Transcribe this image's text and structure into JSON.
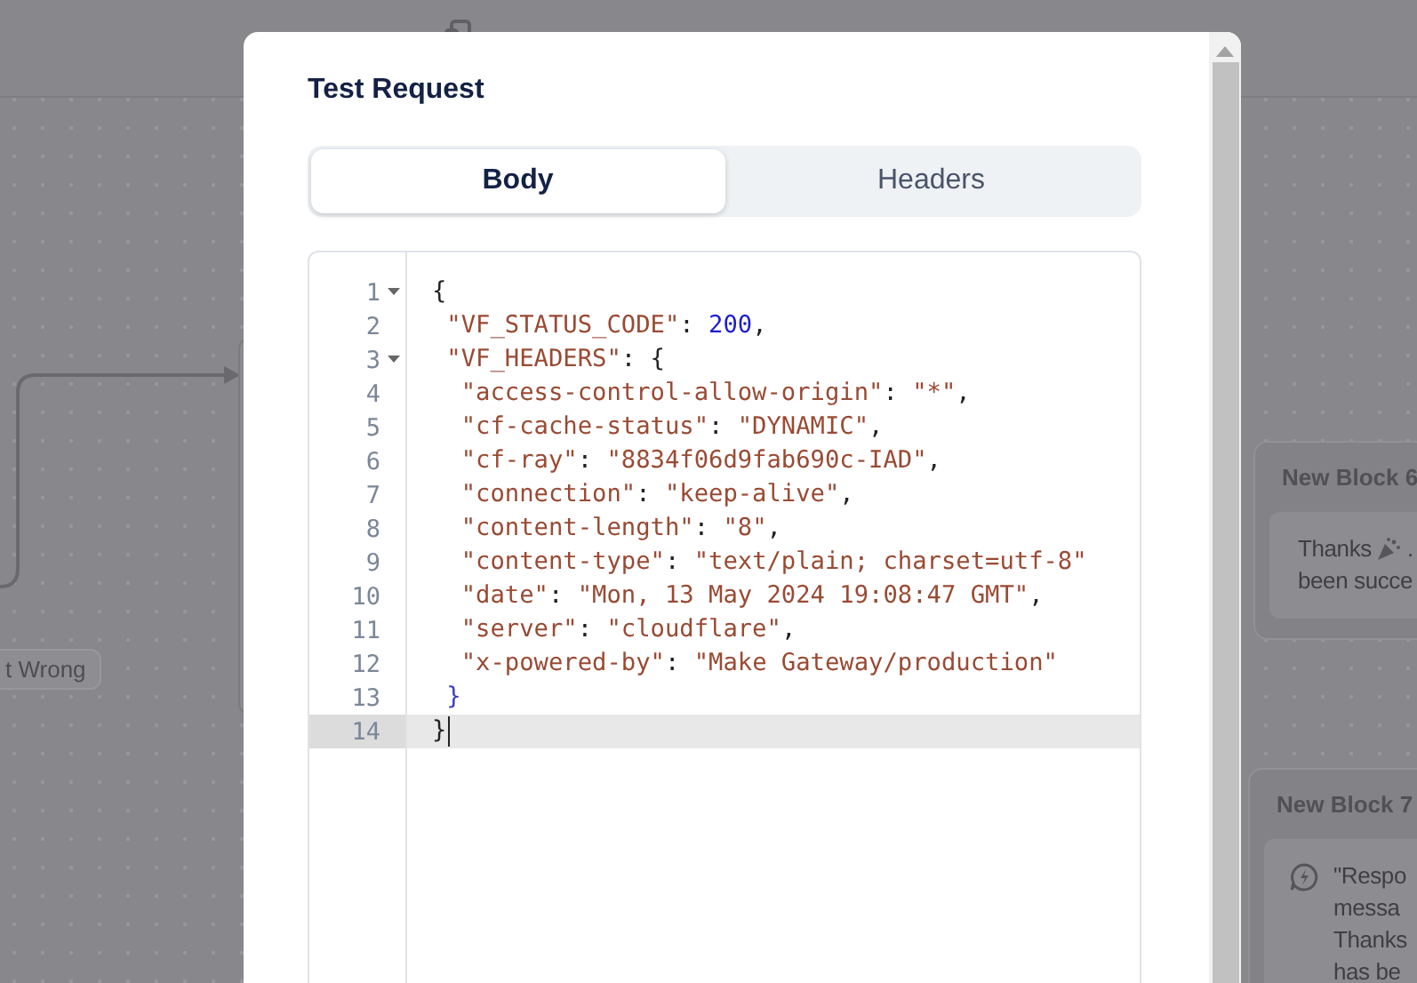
{
  "canvas": {
    "port_label": "t Wrong",
    "block_6": {
      "title": "New Block 6",
      "text_before_icon": "Thanks",
      "text_after_icon": ".",
      "second_line": "been succe"
    },
    "block_7": {
      "title": "New Block 7",
      "lines": [
        "\"Respo",
        "messa",
        "Thanks",
        "has be"
      ]
    }
  },
  "dialog": {
    "title": "Test Request",
    "tabs": [
      {
        "label": "Body",
        "selected": true
      },
      {
        "label": "Headers",
        "selected": false
      }
    ],
    "editor": {
      "lines": [
        {
          "number": "1",
          "fold": true,
          "active": false,
          "tokens": [
            {
              "kind": "punct",
              "text": "{"
            }
          ]
        },
        {
          "number": "2",
          "fold": false,
          "active": false,
          "tokens": [
            {
              "kind": "key",
              "text": " \"VF_STATUS_CODE\""
            },
            {
              "kind": "punct",
              "text": ": "
            },
            {
              "kind": "number",
              "text": "200"
            },
            {
              "kind": "punct",
              "text": ","
            }
          ]
        },
        {
          "number": "3",
          "fold": true,
          "active": false,
          "tokens": [
            {
              "kind": "key",
              "text": " \"VF_HEADERS\""
            },
            {
              "kind": "punct",
              "text": ": {"
            }
          ]
        },
        {
          "number": "4",
          "fold": false,
          "active": false,
          "tokens": [
            {
              "kind": "key",
              "text": "  \"access-control-allow-origin\""
            },
            {
              "kind": "punct",
              "text": ": "
            },
            {
              "kind": "string",
              "text": "\"*\""
            },
            {
              "kind": "punct",
              "text": ","
            }
          ]
        },
        {
          "number": "5",
          "fold": false,
          "active": false,
          "tokens": [
            {
              "kind": "key",
              "text": "  \"cf-cache-status\""
            },
            {
              "kind": "punct",
              "text": ": "
            },
            {
              "kind": "string",
              "text": "\"DYNAMIC\""
            },
            {
              "kind": "punct",
              "text": ","
            }
          ]
        },
        {
          "number": "6",
          "fold": false,
          "active": false,
          "tokens": [
            {
              "kind": "key",
              "text": "  \"cf-ray\""
            },
            {
              "kind": "punct",
              "text": ": "
            },
            {
              "kind": "string",
              "text": "\"8834f06d9fab690c-IAD\""
            },
            {
              "kind": "punct",
              "text": ","
            }
          ]
        },
        {
          "number": "7",
          "fold": false,
          "active": false,
          "tokens": [
            {
              "kind": "key",
              "text": "  \"connection\""
            },
            {
              "kind": "punct",
              "text": ": "
            },
            {
              "kind": "string",
              "text": "\"keep-alive\""
            },
            {
              "kind": "punct",
              "text": ","
            }
          ]
        },
        {
          "number": "8",
          "fold": false,
          "active": false,
          "tokens": [
            {
              "kind": "key",
              "text": "  \"content-length\""
            },
            {
              "kind": "punct",
              "text": ": "
            },
            {
              "kind": "string",
              "text": "\"8\""
            },
            {
              "kind": "punct",
              "text": ","
            }
          ]
        },
        {
          "number": "9",
          "fold": false,
          "active": false,
          "tokens": [
            {
              "kind": "key",
              "text": "  \"content-type\""
            },
            {
              "kind": "punct",
              "text": ": "
            },
            {
              "kind": "string",
              "text": "\"text/plain; charset=utf-8\""
            }
          ]
        },
        {
          "number": "10",
          "fold": false,
          "active": false,
          "tokens": [
            {
              "kind": "key",
              "text": "  \"date\""
            },
            {
              "kind": "punct",
              "text": ": "
            },
            {
              "kind": "string",
              "text": "\"Mon, 13 May 2024 19:08:47 GMT\""
            },
            {
              "kind": "punct",
              "text": ","
            }
          ]
        },
        {
          "number": "11",
          "fold": false,
          "active": false,
          "tokens": [
            {
              "kind": "key",
              "text": "  \"server\""
            },
            {
              "kind": "punct",
              "text": ": "
            },
            {
              "kind": "string",
              "text": "\"cloudflare\""
            },
            {
              "kind": "punct",
              "text": ","
            }
          ]
        },
        {
          "number": "12",
          "fold": false,
          "active": false,
          "tokens": [
            {
              "kind": "key",
              "text": "  \"x-powered-by\""
            },
            {
              "kind": "punct",
              "text": ": "
            },
            {
              "kind": "string",
              "text": "\"Make Gateway/production\""
            }
          ]
        },
        {
          "number": "13",
          "fold": false,
          "active": false,
          "tokens": [
            {
              "kind": "brace",
              "text": " }"
            }
          ]
        },
        {
          "number": "14",
          "fold": false,
          "active": true,
          "tokens": [
            {
              "kind": "punct",
              "text": "}"
            }
          ]
        }
      ]
    }
  }
}
